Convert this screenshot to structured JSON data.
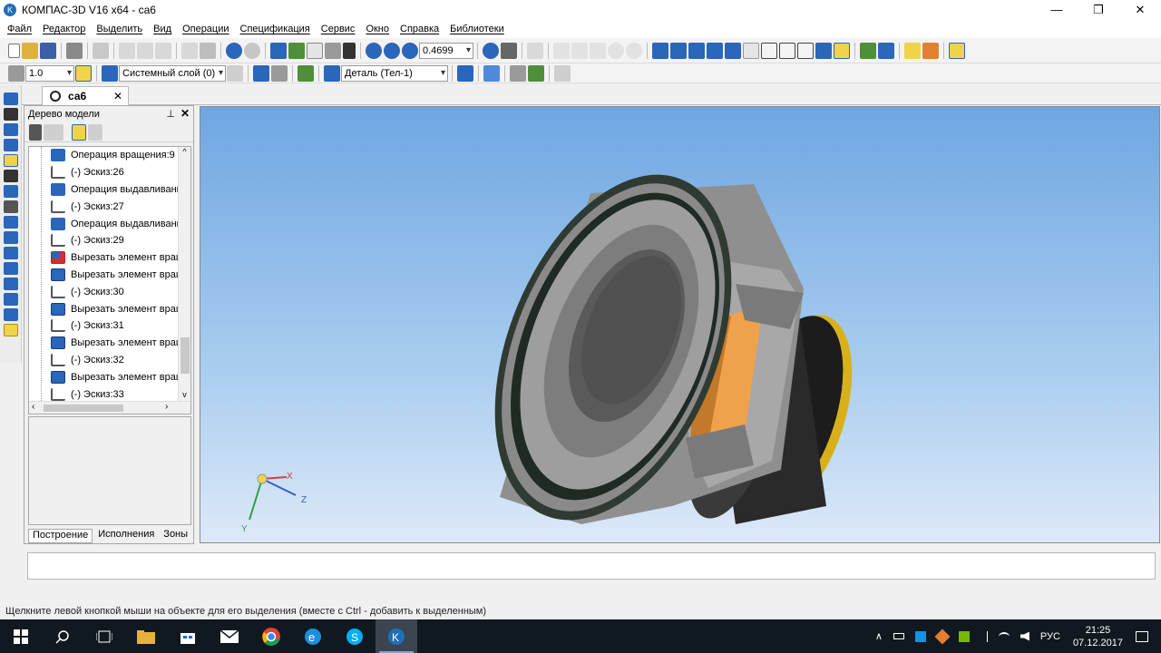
{
  "window": {
    "title": "КОМПАС-3D V16  x64 - са6",
    "minimize_glyph": "—",
    "restore_glyph": "❐",
    "close_glyph": "✕"
  },
  "menu": [
    "Файл",
    "Редактор",
    "Выделить",
    "Вид",
    "Операции",
    "Спецификация",
    "Сервис",
    "Окно",
    "Справка",
    "Библиотеки"
  ],
  "toolbar1": {
    "zoom_value": "0.4699"
  },
  "toolbar2": {
    "step_value": "1.0",
    "layer_value": "Системный слой (0)",
    "part_value": "Деталь (Тел-1)"
  },
  "document_tab": {
    "label": "са6",
    "close": "✕"
  },
  "model_tree": {
    "title": "Дерево модели",
    "pin": "⊥",
    "close": "✕",
    "items": [
      {
        "label": "Операция вращения:9",
        "icon": "revolve-icon"
      },
      {
        "label": "(-) Эскиз:26",
        "icon": "sketch-icon"
      },
      {
        "label": "Операция выдавливания",
        "icon": "extrude-icon"
      },
      {
        "label": "(-) Эскиз:27",
        "icon": "sketch-icon"
      },
      {
        "label": "Операция выдавливания",
        "icon": "extrude-icon"
      },
      {
        "label": "(-) Эскиз:29",
        "icon": "sketch-icon"
      },
      {
        "label": "Вырезать элемент вращения",
        "icon": "cut-revolve-error-icon"
      },
      {
        "label": "Вырезать элемент вращения",
        "icon": "cut-revolve-icon"
      },
      {
        "label": "(-) Эскиз:30",
        "icon": "sketch-icon"
      },
      {
        "label": "Вырезать элемент вращения",
        "icon": "cut-revolve-icon"
      },
      {
        "label": "(-) Эскиз:31",
        "icon": "sketch-icon"
      },
      {
        "label": "Вырезать элемент вращения",
        "icon": "cut-revolve-icon"
      },
      {
        "label": "(-) Эскиз:32",
        "icon": "sketch-icon"
      },
      {
        "label": "Вырезать элемент вращения",
        "icon": "cut-revolve-icon"
      },
      {
        "label": "(-) Эскиз:33",
        "icon": "sketch-icon"
      }
    ],
    "tabs": [
      "Построение",
      "Исполнения",
      "Зоны"
    ]
  },
  "axes": {
    "x": "X",
    "y": "Y",
    "z": "Z"
  },
  "status": {
    "hint": "Щелкните левой кнопкой мыши на объекте для его выделения (вместе с Ctrl - добавить к выделенным)"
  },
  "taskbar": {
    "language": "РУС",
    "time": "21:25",
    "date": "07.12.2017",
    "tray_chevron": "∧"
  },
  "colors": {
    "accent": "#1f6fb8",
    "viewport_top": "#6fa6e2",
    "viewport_bottom": "#dde9f8",
    "speaker_cone": "#5a5a5a",
    "speaker_frame": "#9b9b9b",
    "magnet_ring": "#d8b11a",
    "voice_coil": "#f0a24a"
  }
}
